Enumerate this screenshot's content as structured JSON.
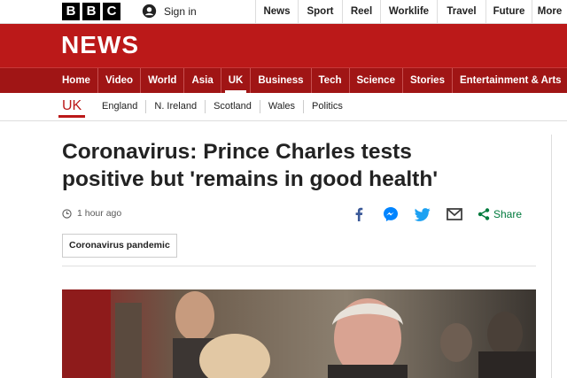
{
  "brand": {
    "letters": [
      "B",
      "B",
      "C"
    ],
    "accent": "#bb1919"
  },
  "signin": {
    "label": "Sign in",
    "icon": "user-icon"
  },
  "topnav": [
    "News",
    "Sport",
    "Reel",
    "Worklife",
    "Travel",
    "Future",
    "More"
  ],
  "masthead": {
    "title": "NEWS"
  },
  "sections": [
    "Home",
    "Video",
    "World",
    "Asia",
    "UK",
    "Business",
    "Tech",
    "Science",
    "Stories",
    "Entertainment & Arts"
  ],
  "active_section": "UK",
  "subnav": {
    "current": "UK",
    "items": [
      "England",
      "N. Ireland",
      "Scotland",
      "Wales",
      "Politics"
    ]
  },
  "article": {
    "headline": "Coronavirus: Prince Charles tests positive but 'remains in good health'",
    "timestamp": "1 hour ago",
    "tag": "Coronavirus pandemic"
  },
  "share": {
    "label": "Share",
    "icons": [
      "facebook-icon",
      "messenger-icon",
      "twitter-icon",
      "email-icon",
      "share-icon"
    ],
    "colors": {
      "facebook": "#3b5998",
      "messenger": "#0084ff",
      "twitter": "#1da1f2",
      "email": "#404040",
      "share": "#007a3d"
    }
  }
}
